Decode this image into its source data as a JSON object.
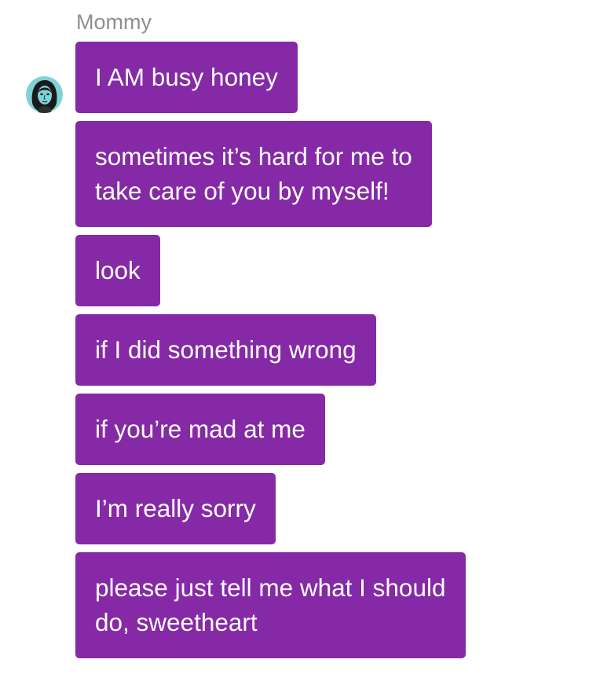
{
  "sender": {
    "name": "Mommy",
    "avatar_icon": "woman-portrait-avatar-icon"
  },
  "messages": [
    {
      "text": "I AM busy honey"
    },
    {
      "text": "sometimes it’s hard for me to\ntake care of you by myself!"
    },
    {
      "text": "look"
    },
    {
      "text": "if I did something wrong"
    },
    {
      "text": "if you’re mad at me"
    },
    {
      "text": "I’m really sorry"
    },
    {
      "text": "please just tell me what I should\ndo, sweetheart"
    }
  ],
  "colors": {
    "bubble": "#8629a6",
    "bubble_text": "#ffffff",
    "sender_name": "#8e8e93",
    "background": "#ffffff"
  }
}
